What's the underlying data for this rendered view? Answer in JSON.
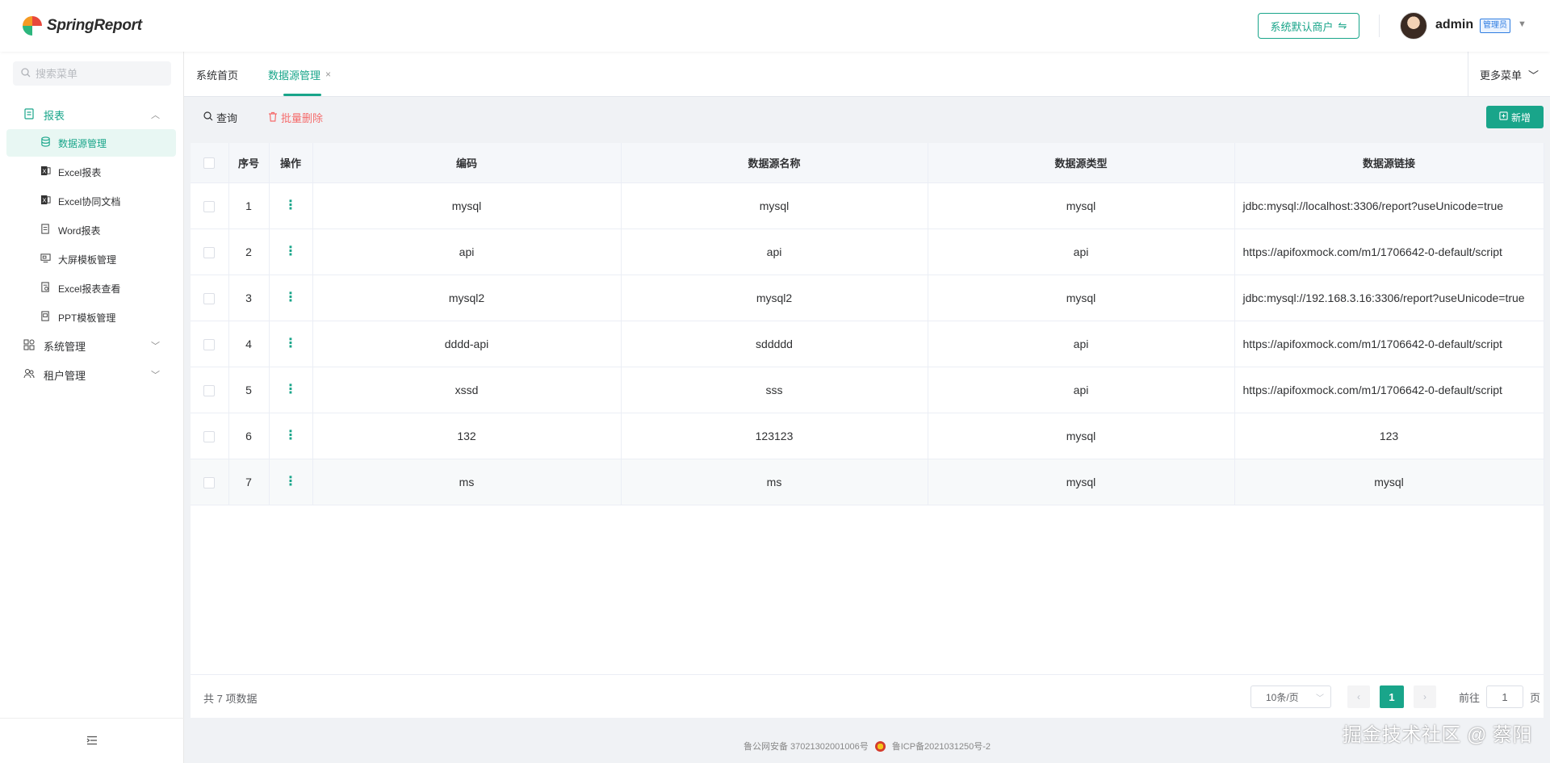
{
  "app": {
    "name": "SpringReport"
  },
  "header": {
    "tenant_label": "系统默认商户",
    "tenant_icon": "switch-icon",
    "user_name": "admin",
    "role_badge": "管理员"
  },
  "sidebar": {
    "search_placeholder": "搜索菜单",
    "groups": [
      {
        "label": "报表",
        "icon": "report-doc-icon",
        "expanded": true,
        "items": [
          {
            "label": "数据源管理",
            "icon": "database-icon",
            "active": true
          },
          {
            "label": "Excel报表",
            "icon": "excel-icon"
          },
          {
            "label": "Excel协同文档",
            "icon": "excel-icon"
          },
          {
            "label": "Word报表",
            "icon": "word-doc-icon"
          },
          {
            "label": "大屏模板管理",
            "icon": "screen-icon"
          },
          {
            "label": "Excel报表查看",
            "icon": "doc-search-icon"
          },
          {
            "label": "PPT模板管理",
            "icon": "ppt-icon"
          }
        ]
      },
      {
        "label": "系统管理",
        "icon": "apps-grid-icon",
        "expanded": false
      },
      {
        "label": "租户管理",
        "icon": "users-icon",
        "expanded": false
      }
    ]
  },
  "tabs": [
    {
      "label": "系统首页",
      "active": false
    },
    {
      "label": "数据源管理",
      "active": true,
      "closable": true
    }
  ],
  "more_menu_label": "更多菜单",
  "toolbar": {
    "query_label": "查询",
    "batch_delete_label": "批量删除",
    "add_label": "新增"
  },
  "table": {
    "columns": [
      "序号",
      "操作",
      "编码",
      "数据源名称",
      "数据源类型",
      "数据源链接"
    ],
    "rows": [
      {
        "index": "1",
        "code": "mysql",
        "name": "mysql",
        "type": "mysql",
        "link": "jdbc:mysql://localhost:3306/report?useUnicode=true"
      },
      {
        "index": "2",
        "code": "api",
        "name": "api",
        "type": "api",
        "link": "https://apifoxmock.com/m1/1706642-0-default/script"
      },
      {
        "index": "3",
        "code": "mysql2",
        "name": "mysql2",
        "type": "mysql",
        "link": "jdbc:mysql://192.168.3.16:3306/report?useUnicode=true"
      },
      {
        "index": "4",
        "code": "dddd-api",
        "name": "sddddd",
        "type": "api",
        "link": "https://apifoxmock.com/m1/1706642-0-default/script"
      },
      {
        "index": "5",
        "code": "xssd",
        "name": "sss",
        "type": "api",
        "link": "https://apifoxmock.com/m1/1706642-0-default/script"
      },
      {
        "index": "6",
        "code": "132",
        "name": "123123",
        "type": "mysql",
        "link": "123"
      },
      {
        "index": "7",
        "code": "ms",
        "name": "ms",
        "type": "mysql",
        "link": "mysql"
      }
    ]
  },
  "pagination": {
    "total_text": "共 7 项数据",
    "page_size": "10条/页",
    "current_page": "1",
    "goto_label": "前往",
    "goto_value": "1",
    "goto_suffix": "页"
  },
  "footer": {
    "police_record": "鲁公网安备 37021302001006号",
    "icp_record": "鲁ICP备2021031250号-2",
    "watermark": "掘金技术社区 @ 蔡阳"
  },
  "colors": {
    "accent": "#19a58a",
    "danger": "#f56c6c"
  }
}
